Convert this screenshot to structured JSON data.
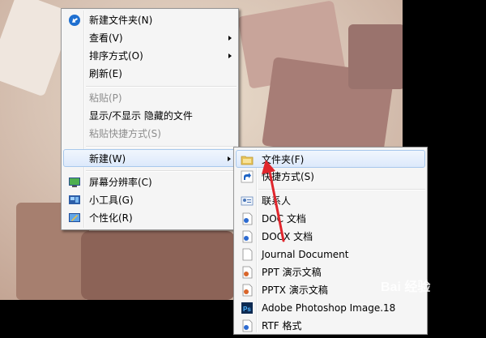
{
  "main_menu": {
    "items": [
      {
        "label": "新建文件夹(N)",
        "icon": "new-folder-icon",
        "enabled": true
      },
      {
        "label": "查看(V)",
        "submenu": true,
        "enabled": true
      },
      {
        "label": "排序方式(O)",
        "submenu": true,
        "enabled": true
      },
      {
        "label": "刷新(E)",
        "enabled": true
      },
      {
        "label": "粘贴(P)",
        "enabled": false
      },
      {
        "label": "显示/不显示 隐藏的文件",
        "enabled": true
      },
      {
        "label": "粘贴快捷方式(S)",
        "enabled": false
      },
      {
        "label": "新建(W)",
        "submenu": true,
        "enabled": true,
        "highlighted": true
      },
      {
        "label": "屏幕分辨率(C)",
        "icon": "screen-resolution-icon",
        "enabled": true
      },
      {
        "label": "小工具(G)",
        "icon": "gadgets-icon",
        "enabled": true
      },
      {
        "label": "个性化(R)",
        "icon": "personalize-icon",
        "enabled": true
      }
    ]
  },
  "new_submenu": {
    "items": [
      {
        "label": "文件夹(F)",
        "icon": "folder-icon",
        "highlighted": true
      },
      {
        "label": "快捷方式(S)",
        "icon": "shortcut-icon"
      },
      {
        "label": "联系人",
        "icon": "contact-icon"
      },
      {
        "label": "DOC 文档",
        "icon": "doc-icon"
      },
      {
        "label": "DOCX 文档",
        "icon": "docx-icon"
      },
      {
        "label": "Journal Document",
        "icon": "journal-icon"
      },
      {
        "label": "PPT 演示文稿",
        "icon": "ppt-icon"
      },
      {
        "label": "PPTX 演示文稿",
        "icon": "pptx-icon"
      },
      {
        "label": "Adobe Photoshop Image.18",
        "icon": "photoshop-icon"
      },
      {
        "label": "RTF 格式",
        "icon": "rtf-icon"
      }
    ]
  },
  "watermark": {
    "text": "Bai 经验"
  },
  "colors": {
    "highlight_border": "#a8c8ec",
    "arrow_red": "#e0262d"
  }
}
